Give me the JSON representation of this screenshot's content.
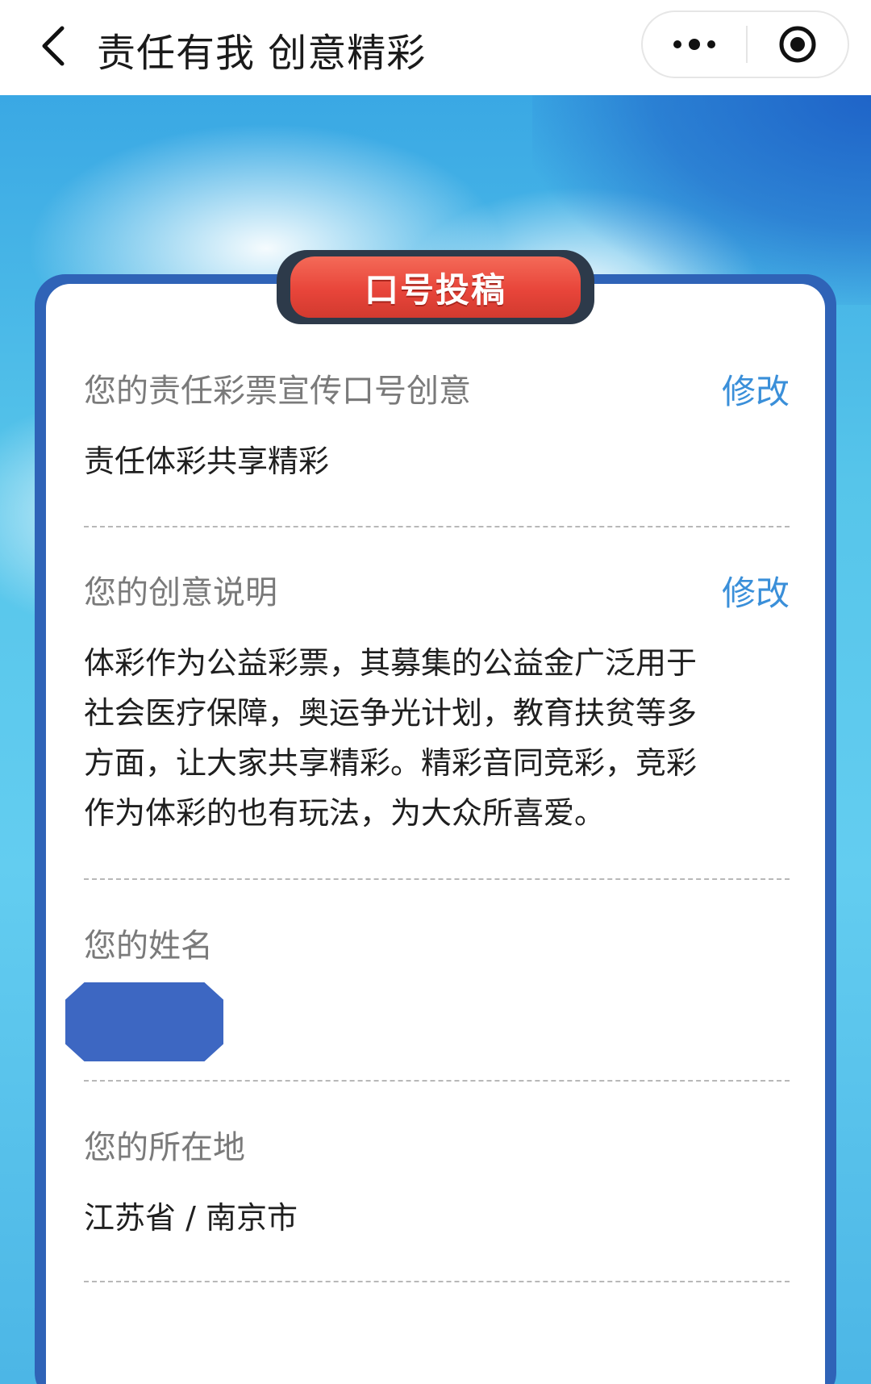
{
  "navbar": {
    "title": "责任有我 创意精彩"
  },
  "card": {
    "header": "口号投稿",
    "slogan": {
      "label": "您的责任彩票宣传口号创意",
      "edit_label": "修改",
      "value": "责任体彩共享精彩"
    },
    "description": {
      "label": "您的创意说明",
      "edit_label": "修改",
      "lines": [
        "体彩作为公益彩票，其募集的公益金广泛用于",
        "社会医疗保障，奥运争光计划，教育扶贫等多",
        "方面，让大家共享精彩。精彩音同竞彩，竞彩",
        "作为体彩的也有玩法，为大众所喜爱。"
      ]
    },
    "name": {
      "label": "您的姓名"
    },
    "location": {
      "label": "您的所在地",
      "value": "江苏省 / 南京市"
    }
  },
  "colors": {
    "accent_blue": "#3a8fd9",
    "card_border": "#2f63b7",
    "ribbon_red": "#e8453a"
  },
  "icons": [
    "back-icon",
    "more-icon",
    "close-capsule-icon"
  ]
}
